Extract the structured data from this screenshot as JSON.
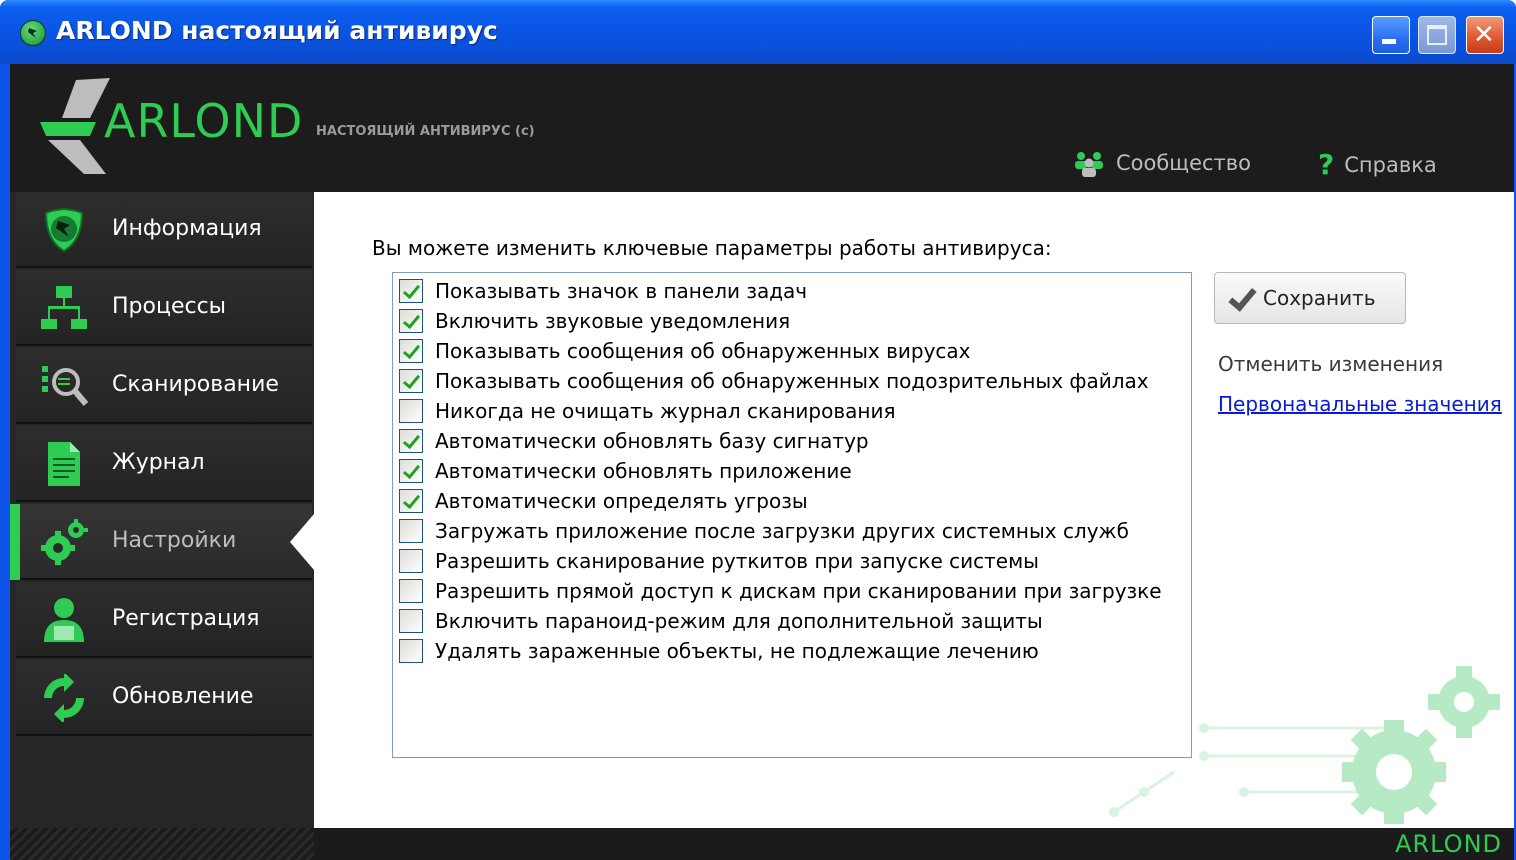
{
  "window": {
    "title": "ARLOND настоящий антивирус"
  },
  "header": {
    "logo_text": "ARLOND",
    "logo_subtitle": "НАСТОЯЩИЙ АНТИВИРУС (с)",
    "community_label": "Сообщество",
    "help_label": "Справка"
  },
  "sidebar": {
    "items": [
      {
        "label": "Информация",
        "icon": "shield-icon"
      },
      {
        "label": "Процессы",
        "icon": "process-tree-icon"
      },
      {
        "label": "Сканирование",
        "icon": "scan-magnifier-icon"
      },
      {
        "label": "Журнал",
        "icon": "document-icon"
      },
      {
        "label": "Настройки",
        "icon": "gears-icon",
        "active": true
      },
      {
        "label": "Регистрация",
        "icon": "user-icon"
      },
      {
        "label": "Обновление",
        "icon": "refresh-icon"
      }
    ]
  },
  "settings": {
    "intro": "Вы можете изменить ключевые параметры работы антивируса:",
    "options": [
      {
        "label": "Показывать значок в панели задач",
        "checked": true
      },
      {
        "label": "Включить звуковые уведомления",
        "checked": true
      },
      {
        "label": "Показывать сообщения об обнаруженных вирусах",
        "checked": true
      },
      {
        "label": "Показывать сообщения об обнаруженных подозрительных файлах",
        "checked": true
      },
      {
        "label": "Никогда не очищать журнал сканирования",
        "checked": false
      },
      {
        "label": "Автоматически обновлять базу сигнатур",
        "checked": true
      },
      {
        "label": "Автоматически обновлять приложение",
        "checked": true
      },
      {
        "label": "Автоматически определять угрозы",
        "checked": true
      },
      {
        "label": "Загружать приложение после загрузки других системных служб",
        "checked": false
      },
      {
        "label": "Разрешить сканирование руткитов при запуске системы",
        "checked": false
      },
      {
        "label": "Разрешить прямой доступ к дискам при сканировании при загрузке",
        "checked": false
      },
      {
        "label": "Включить параноид-режим для дополнительной защиты",
        "checked": false
      },
      {
        "label": "Удалять зараженные объекты, не подлежащие лечению",
        "checked": false
      }
    ],
    "save_label": "Сохранить",
    "cancel_label": "Отменить изменения",
    "defaults_label": "Первоначальные значения"
  },
  "footer": {
    "logo_text": "ARLOND"
  },
  "colors": {
    "accent": "#2ecc52",
    "titlebar": "#0a54e2",
    "dark": "#1c1c1c",
    "link": "#0a1bd8"
  }
}
